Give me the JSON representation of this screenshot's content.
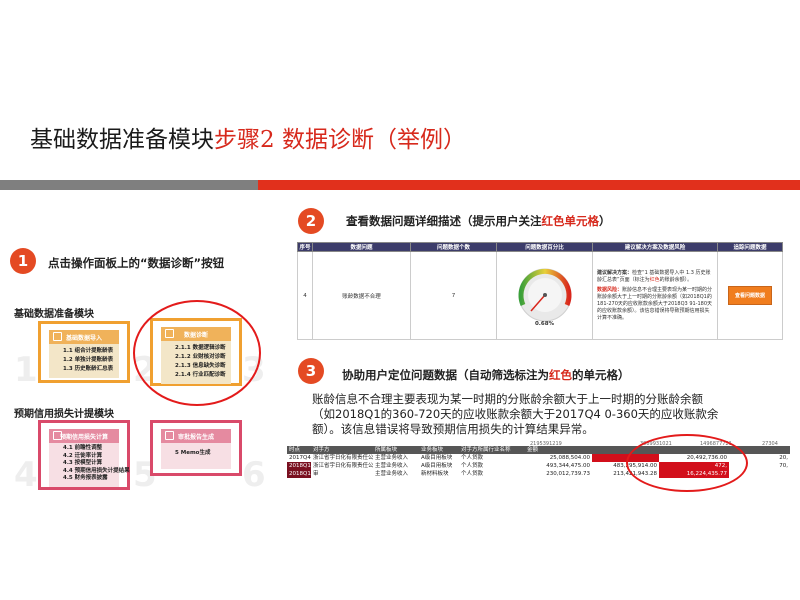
{
  "title": {
    "prefix": "基础数据准备模块",
    "highlight": "步骤2 数据诊断（举例）"
  },
  "step1": {
    "number": "1",
    "text": "点击操作面板上的“数据诊断”按钮"
  },
  "left_panel": {
    "section1_label": "基础数据准备模块",
    "section2_label": "预期信用损失计提模块",
    "cards": [
      {
        "title": "基础数据导入",
        "items": [
          "1.1 组合计提账龄表",
          "1.2 单独计提账龄表",
          "1.3 历史账龄汇总表"
        ]
      },
      {
        "title": "数据诊断",
        "items": [
          "2.1.1 数据逻辑诊断",
          "2.1.2 业财核对诊断",
          "2.1.3 信息缺失诊断",
          "2.1.4 行业匹配诊断"
        ]
      },
      {
        "title": "预期信用损失计算",
        "items": [
          "4.1 前瞻性调整",
          "4.2 迁徙率计算",
          "4.3 按模型计算",
          "4.4 预期信用损失计提结果",
          "4.5 财务报表披露"
        ]
      },
      {
        "title": "审批报告生成",
        "items": [
          "5 Memo生成"
        ]
      }
    ],
    "watermark_digits": [
      "1",
      "2",
      "3",
      "4",
      "5",
      "6"
    ]
  },
  "step2": {
    "number": "2",
    "text_prefix": "查看数据问题详细描述（提示用户关注",
    "text_highlight": "红色单元格",
    "text_suffix": "）"
  },
  "issue_table": {
    "headers": [
      "序号",
      "数据问题",
      "问题数据个数",
      "问题数据百分比",
      "建议解决方案及数据风险",
      "追踪问题数据"
    ],
    "row": {
      "index": "4",
      "problem": "账龄数据不合理",
      "count": "7",
      "percent_label": "0.68%",
      "percent_value": 0.68,
      "suggestion_label": "建议解决方案：",
      "suggestion_text1": "检查“1 基础数据导入中 1.3 历史账龄汇总表”页面（标注为",
      "suggestion_highlight": "红色",
      "suggestion_text2": "的账龄余额）。",
      "risk_label": "数据风险：",
      "risk_text": "账龄信息不合理主要表现为某一时期的分账龄余额大于上一时期的分账龄余额（如2018Q1的181-270天的应收账款余额大于2018Q3 91-180天的应收账款余额）。该信息错误将导致预期信用损失计算不准确。",
      "button_label": "查看问题数据"
    }
  },
  "step3": {
    "number": "3",
    "text_prefix": "协助用户定位问题数据（自动筛选标注为",
    "text_highlight": "红色",
    "text_suffix": "的单元格）"
  },
  "paragraph": "账龄信息不合理主要表现为某一时期的分账龄余额大于上一时期的分账龄余额（如2018Q1的360-720天的应收账款余额大于2017Q4 0-360天的应收账款余额）。该信息错误将导致预期信用损失的计算结果异常。",
  "data_table": {
    "top_numbers": [
      "2195391219",
      "3089931021",
      "1496877721",
      "27304"
    ],
    "headers": [
      "时点",
      "对手方",
      "所属板块",
      "业务板块",
      "对手方所属行业名称",
      "金额",
      "",
      "",
      ""
    ],
    "rows": [
      [
        "2017Q4",
        "浙江省宇日化有限责任公司",
        "主营业务收入",
        "A级目用板块",
        "个人贷款",
        "25,088,504.00",
        "",
        "20,492,736.00",
        "20,"
      ],
      [
        "2018Q1",
        "浙江省宇日化有限责任公司",
        "主营业务收入",
        "A级目用板块",
        "个人贷款",
        "493,344,475.00",
        "483,295,914.00",
        "472,",
        "70,"
      ],
      [
        "2018Q1",
        "审",
        "主营业务收入",
        "新材料板块",
        "个人贷款",
        "230,012,739.73",
        "213,421,943.28",
        "16,224,435.77",
        ""
      ]
    ]
  }
}
